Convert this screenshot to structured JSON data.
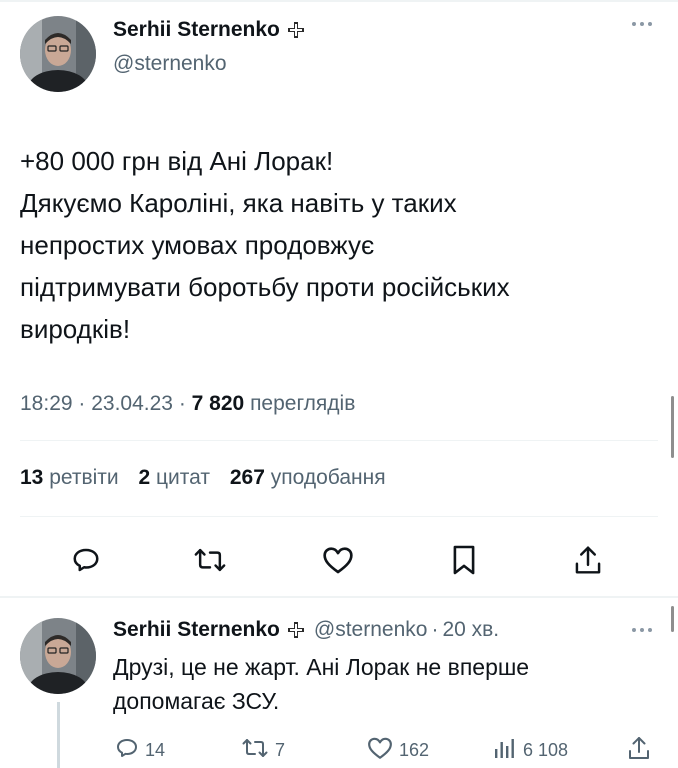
{
  "colors": {
    "text": "#0f1419",
    "secondary": "#536471",
    "divider": "#eff3f4"
  },
  "main_tweet": {
    "author_name": "Serhii Sternenko",
    "author_handle": "@sternenko",
    "badge_icon": "cross-badge-icon",
    "text_lines": [
      "+80 000 грн від Ані Лорак!",
      "Дякуємо Кароліні, яка навіть у таких",
      "непростих умовах продовжує",
      "підтримувати боротьбу проти російських",
      "виродків!"
    ],
    "time": "18:29",
    "date": "23.04.23",
    "views_count": "7 820",
    "views_label": "переглядів",
    "retweets_count": "13",
    "retweets_label": "ретвіти",
    "quotes_count": "2",
    "quotes_label": "цитат",
    "likes_count": "267",
    "likes_label": "уподобання",
    "actions": [
      "reply-icon",
      "retweet-icon",
      "like-icon",
      "bookmark-icon",
      "share-icon"
    ]
  },
  "reply_tweet": {
    "author_name": "Serhii Sternenko",
    "author_handle": "@sternenko",
    "time_ago": "20 хв.",
    "text_lines": [
      "Друзі, це не жарт. Ані Лорак не вперше",
      "допомагає ЗСУ."
    ],
    "replies": "14",
    "retweets": "7",
    "likes": "162",
    "views": "6 108"
  }
}
